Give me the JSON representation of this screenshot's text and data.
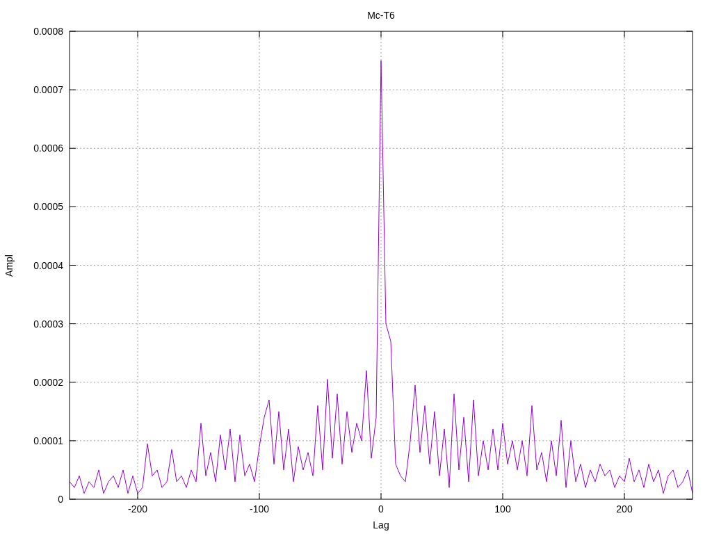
{
  "chart_data": {
    "type": "line",
    "title": "Mc-T6",
    "xlabel": "Lag",
    "ylabel": "Ampl",
    "xlim": [
      -256,
      256
    ],
    "ylim": [
      0,
      0.0008
    ],
    "xticks": [
      -200,
      -100,
      0,
      100,
      200
    ],
    "yticks": [
      {
        "value": 0,
        "label": "0"
      },
      {
        "value": 0.0001,
        "label": "0.0001"
      },
      {
        "value": 0.0002,
        "label": "0.0002"
      },
      {
        "value": 0.0003,
        "label": "0.0003"
      },
      {
        "value": 0.0004,
        "label": "0.0004"
      },
      {
        "value": 0.0005,
        "label": "0.0005"
      },
      {
        "value": 0.0006,
        "label": "0.0006"
      },
      {
        "value": 0.0007,
        "label": "0.0007"
      },
      {
        "value": 0.0008,
        "label": "0.0008"
      }
    ],
    "grid": true,
    "x": [
      -256,
      -252,
      -248,
      -244,
      -240,
      -236,
      -232,
      -228,
      -224,
      -220,
      -216,
      -212,
      -208,
      -204,
      -200,
      -196,
      -192,
      -188,
      -184,
      -180,
      -176,
      -172,
      -168,
      -164,
      -160,
      -156,
      -152,
      -148,
      -144,
      -140,
      -136,
      -132,
      -128,
      -124,
      -120,
      -116,
      -112,
      -108,
      -104,
      -100,
      -96,
      -92,
      -88,
      -84,
      -80,
      -76,
      -72,
      -68,
      -64,
      -60,
      -56,
      -52,
      -48,
      -44,
      -40,
      -36,
      -32,
      -28,
      -24,
      -20,
      -16,
      -12,
      -8,
      -4,
      0,
      4,
      8,
      12,
      16,
      20,
      24,
      28,
      32,
      36,
      40,
      44,
      48,
      52,
      56,
      60,
      64,
      68,
      72,
      76,
      80,
      84,
      88,
      92,
      96,
      100,
      104,
      108,
      112,
      116,
      120,
      124,
      128,
      132,
      136,
      140,
      144,
      148,
      152,
      156,
      160,
      164,
      168,
      172,
      176,
      180,
      184,
      188,
      192,
      196,
      200,
      204,
      208,
      212,
      216,
      220,
      224,
      228,
      232,
      236,
      240,
      244,
      248,
      252,
      256
    ],
    "series": [
      {
        "color": "#9400d3",
        "values": [
          3e-05,
          2e-05,
          4e-05,
          1e-05,
          3e-05,
          2e-05,
          5e-05,
          1e-05,
          3e-05,
          4e-05,
          2e-05,
          5e-05,
          1e-05,
          4e-05,
          1e-05,
          2e-05,
          9.5e-05,
          4e-05,
          5e-05,
          2e-05,
          3e-05,
          8.5e-05,
          3e-05,
          4e-05,
          2e-05,
          5e-05,
          3e-05,
          0.00013,
          4e-05,
          8e-05,
          3e-05,
          0.00011,
          5e-05,
          0.00012,
          3e-05,
          0.00011,
          4e-05,
          6e-05,
          3e-05,
          9e-05,
          0.00014,
          0.00017,
          6e-05,
          0.00015,
          5e-05,
          0.00012,
          3e-05,
          9e-05,
          5e-05,
          8e-05,
          4e-05,
          0.00016,
          5e-05,
          0.000205,
          7e-05,
          0.00018,
          6e-05,
          0.00015,
          8e-05,
          0.00013,
          0.0001,
          0.00022,
          7e-05,
          0.00014,
          0.00075,
          0.0003,
          0.00027,
          6e-05,
          4e-05,
          3e-05,
          0.0001,
          0.000195,
          8e-05,
          0.00016,
          6e-05,
          0.00015,
          4e-05,
          0.00012,
          2e-05,
          0.00018,
          5e-05,
          0.00014,
          3e-05,
          0.00017,
          4e-05,
          0.0001,
          5e-05,
          0.00012,
          5e-05,
          0.00013,
          6e-05,
          0.0001,
          5e-05,
          0.0001,
          4e-05,
          0.00016,
          5e-05,
          8e-05,
          3e-05,
          0.0001,
          4e-05,
          0.000135,
          2e-05,
          0.0001,
          3e-05,
          6e-05,
          2e-05,
          5e-05,
          3e-05,
          6e-05,
          4e-05,
          5e-05,
          2e-05,
          4e-05,
          3e-05,
          7e-05,
          3e-05,
          5e-05,
          2e-05,
          6e-05,
          3e-05,
          5e-05,
          1e-05,
          4e-05,
          5e-05,
          2e-05,
          3e-05,
          5e-05,
          1e-05
        ]
      }
    ]
  }
}
